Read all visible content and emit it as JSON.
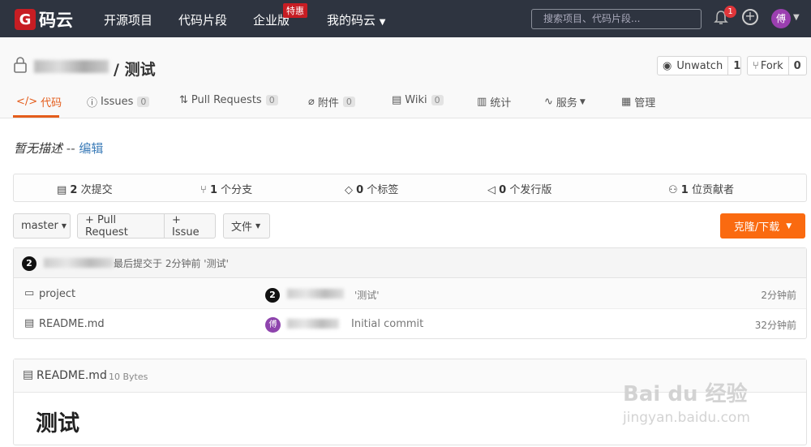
{
  "nav": {
    "logo_text": "码云",
    "links": [
      "开源项目",
      "代码片段",
      "企业版",
      "我的码云"
    ],
    "hot_badge": "特惠",
    "search_placeholder": "搜索项目、代码片段...",
    "notification_count": "1",
    "avatar_letter": "傅"
  },
  "project": {
    "separator": "/",
    "name": "测试",
    "watch_label": "Unwatch",
    "watch_count": "1",
    "fork_label": "Fork",
    "fork_count": "0"
  },
  "tabs": [
    {
      "label": "代码",
      "count": ""
    },
    {
      "label": "Issues",
      "count": "0"
    },
    {
      "label": "Pull Requests",
      "count": "0"
    },
    {
      "label": "附件",
      "count": "0"
    },
    {
      "label": "Wiki",
      "count": "0"
    },
    {
      "label": "统计",
      "count": ""
    },
    {
      "label": "服务",
      "count": ""
    },
    {
      "label": "管理",
      "count": ""
    }
  ],
  "description": {
    "text": "暂无描述",
    "sep": "--",
    "edit": "编辑"
  },
  "stats": [
    {
      "num": "2",
      "label": "次提交"
    },
    {
      "num": "1",
      "label": "个分支"
    },
    {
      "num": "0",
      "label": "个标签"
    },
    {
      "num": "0",
      "label": "个发行版"
    },
    {
      "num": "1",
      "label": "位贡献者"
    }
  ],
  "toolbar": {
    "branch": "master",
    "pull_request": "+ Pull Request",
    "issue": "+ Issue",
    "files": "文件",
    "clone": "克隆/下载"
  },
  "last_commit": {
    "marker": "2",
    "text": "最后提交于 2分钟前 '测试'"
  },
  "files": [
    {
      "name": "project",
      "type": "folder",
      "marker": "2",
      "message": "'测试'",
      "time": "2分钟前"
    },
    {
      "name": "README.md",
      "type": "file",
      "avatar": "傅",
      "message": "Initial commit",
      "time": "32分钟前"
    }
  ],
  "readme": {
    "filename": "README.md",
    "size": "10 Bytes",
    "heading": "测试"
  },
  "watermark": {
    "brand": "Bai du 经验",
    "url": "jingyan.baidu.com"
  }
}
